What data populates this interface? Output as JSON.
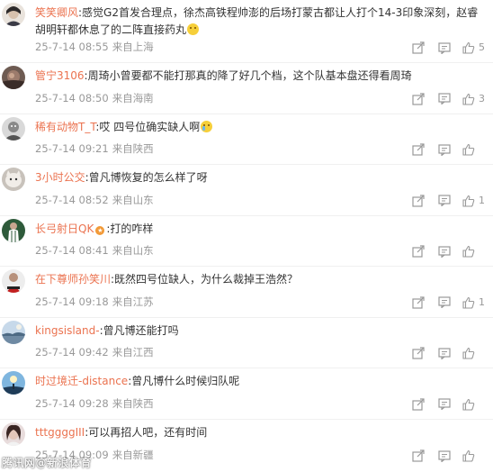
{
  "colors": {
    "username": "#eb7350",
    "meta": "#999999",
    "text": "#333333"
  },
  "icons": {
    "share": "share-icon",
    "reply": "reply-icon",
    "like": "thumbs-up-icon"
  },
  "comments": [
    {
      "username": "笑笑卿风",
      "text": ":感觉G2首发合理点，徐杰高铁程帅澎的后场打蒙古都让人打个14-3印象深刻，赵睿胡明轩都休息了的二阵直接药丸",
      "emoji": "grin",
      "time": "25-7-14 08:55",
      "location": "来自上海",
      "likes": "5",
      "avatar": "profile-photo"
    },
    {
      "username": "管宁3106",
      "text": ":周琦小曾要都不能打那真的降了好几个档，这个队基本盘还得看周琦",
      "time": "25-7-14 08:50",
      "location": "来自海南",
      "likes": "3",
      "avatar": "profile-photo"
    },
    {
      "username": "稀有动物T_T",
      "text": ":哎 四号位确实缺人啊",
      "emoji": "cry",
      "time": "25-7-14 09:21",
      "location": "来自陕西",
      "likes": "",
      "avatar": "profile-photo"
    },
    {
      "username": "3小时公交",
      "text": ":曾凡博恢复的怎么样了呀",
      "time": "25-7-14 08:52",
      "location": "来自山东",
      "likes": "1",
      "avatar": "profile-photo"
    },
    {
      "username": "长弓射日QK",
      "text": ":打的咋样",
      "badge": "crown",
      "time": "25-7-14 08:41",
      "location": "来自山东",
      "likes": "",
      "avatar": "profile-photo"
    },
    {
      "username": "在下尊师孙笑川",
      "text": ":既然四号位缺人，为什么裁掉王浩然？",
      "time": "25-7-14 09:18",
      "location": "来自江苏",
      "likes": "1",
      "avatar": "profile-photo"
    },
    {
      "username": "kingsisland-",
      "text": ":曾凡博还能打吗",
      "time": "25-7-14 09:42",
      "location": "来自江西",
      "likes": "",
      "avatar": "profile-photo"
    },
    {
      "username": "时过境迁-distance",
      "text": ":曾凡博什么时候归队呢",
      "time": "25-7-14 09:28",
      "location": "来自陕西",
      "likes": "",
      "avatar": "profile-photo"
    },
    {
      "username": "tttggggIII",
      "text": ":可以再招人吧，还有时间",
      "time": "25-7-14 09:09",
      "location": "来自新疆",
      "likes": "",
      "avatar": "profile-photo"
    }
  ],
  "watermark": "腾讯网@新浪体育"
}
